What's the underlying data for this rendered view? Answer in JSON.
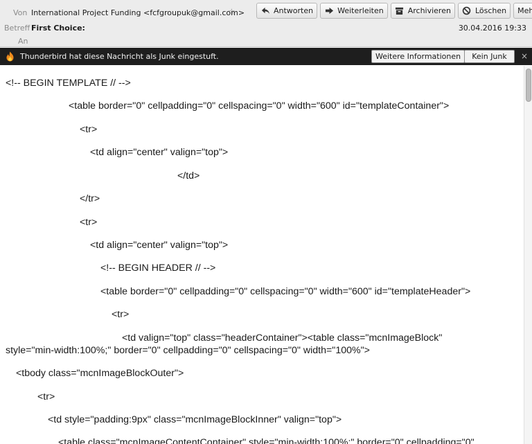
{
  "header": {
    "from_label": "Von",
    "from_value": "International Project Funding <fcfgroupuk@gmail.com>",
    "subject_label": "Betreff",
    "subject_value": "First Choice:",
    "to_label": "An",
    "date": "30.04.2016 19:33",
    "toolbar": [
      {
        "name": "reply-button",
        "label": "Antworten",
        "icon": "reply-arrow-icon"
      },
      {
        "name": "forward-button",
        "label": "Weiterleiten",
        "icon": "forward-arrow-icon"
      },
      {
        "name": "archive-button",
        "label": "Archivieren",
        "icon": "archive-box-icon"
      },
      {
        "name": "delete-button",
        "label": "Löschen",
        "icon": "no-entry-icon"
      },
      {
        "name": "more-button",
        "label": "Mehr",
        "icon": "chevron-down-icon"
      }
    ]
  },
  "junk_bar": {
    "message": "Thunderbird hat diese Nachricht als Junk eingestuft.",
    "more_info_label": "Weitere Informationen",
    "not_junk_label": "Kein Junk",
    "close_glyph": "×",
    "icon": "flame-icon"
  },
  "body_lines": [
    "<!-- BEGIN TEMPLATE // -->",
    "<table border=\"0\" cellpadding=\"0\" cellspacing=\"0\" width=\"600\" id=\"templateContainer\">",
    "<tr>",
    "<td align=\"center\" valign=\"top\">",
    "</td>",
    "</tr>",
    "<tr>",
    "<td align=\"center\" valign=\"top\">",
    "<!-- BEGIN HEADER // -->",
    "<table border=\"0\" cellpadding=\"0\" cellspacing=\"0\" width=\"600\" id=\"templateHeader\">",
    "<tr>",
    "<td valign=\"top\" class=\"headerContainer\"><table class=\"mcnImageBlock\"",
    "style=\"min-width:100%;\" border=\"0\" cellpadding=\"0\" cellspacing=\"0\" width=\"100%\">",
    "<tbody class=\"mcnImageBlockOuter\">",
    "<tr>",
    "<td style=\"padding:9px\" class=\"mcnImageBlockInner\" valign=\"top\">",
    "<table class=\"mcnImageContentContainer\" style=\"min-width:100%;\" border=\"0\" cellpadding=\"0\""
  ]
}
